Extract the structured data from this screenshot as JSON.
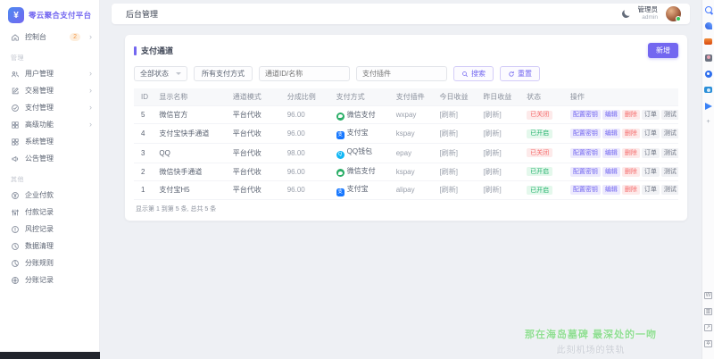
{
  "colors": {
    "accent": "#7367f0",
    "success": "#23b26d",
    "danger": "#f56c6c"
  },
  "sidebar": {
    "logo_title": "零云聚合支付平台",
    "console": {
      "label": "控制台",
      "badge": "2"
    },
    "sections": [
      {
        "label": "管理",
        "items": [
          {
            "label": "用户管理",
            "icon": "users-icon",
            "arrow": true
          },
          {
            "label": "交易管理",
            "icon": "edit-icon",
            "arrow": true
          },
          {
            "label": "支付管理",
            "icon": "check-circle-icon",
            "arrow": true
          },
          {
            "label": "高级功能",
            "icon": "grid-icon",
            "arrow": true
          },
          {
            "label": "系统管理",
            "icon": "modules-icon",
            "arrow": false
          },
          {
            "label": "公告管理",
            "icon": "announcement-icon",
            "arrow": false
          }
        ]
      },
      {
        "label": "其他",
        "items": [
          {
            "label": "企业付款",
            "icon": "enterprise-pay-icon",
            "arrow": false
          },
          {
            "label": "付款记录",
            "icon": "payment-records-icon",
            "arrow": false
          },
          {
            "label": "风控记录",
            "icon": "risk-icon",
            "arrow": false
          },
          {
            "label": "数据清理",
            "icon": "clock-icon",
            "arrow": false
          },
          {
            "label": "分账规则",
            "icon": "split-rules-icon",
            "arrow": false
          },
          {
            "label": "分账记录",
            "icon": "split-records-icon",
            "arrow": false
          }
        ]
      }
    ]
  },
  "topbar": {
    "title": "后台管理",
    "user_name": "管理员",
    "user_role": "admin"
  },
  "panel": {
    "title": "支付通道",
    "add_button": "新增",
    "filters": {
      "status_select": "全部状态",
      "method_select": "所有支付方式",
      "id_placeholder": "通道ID/名称",
      "plugin_placeholder": "支付插件",
      "search_button": "搜索",
      "reset_button": "重置"
    },
    "table": {
      "headers": [
        "ID",
        "显示名称",
        "通道模式",
        "分成比例",
        "支付方式",
        "支付插件",
        "今日收益",
        "昨日收益",
        "状态",
        "操作"
      ],
      "actions": [
        {
          "label": "配置密钥",
          "type": "primary"
        },
        {
          "label": "编辑",
          "type": "primary"
        },
        {
          "label": "删除",
          "type": "danger"
        },
        {
          "label": "订单",
          "type": "plain"
        },
        {
          "label": "测试",
          "type": "plain"
        }
      ],
      "rows": [
        {
          "id": "5",
          "name": "微信官方",
          "mode": "平台代收",
          "ratio": "96.00",
          "method": "微信支付",
          "method_icon": "wechat-pay-icon",
          "plugin": "wxpay",
          "today": "[刷新]",
          "yesterday": "[刷新]",
          "status": "已关闭",
          "status_state": "closed"
        },
        {
          "id": "4",
          "name": "支付宝快手通道",
          "mode": "平台代收",
          "ratio": "96.00",
          "method": "支付宝",
          "method_icon": "alipay-icon",
          "plugin": "kspay",
          "today": "[刷新]",
          "yesterday": "[刷新]",
          "status": "已开启",
          "status_state": "open"
        },
        {
          "id": "3",
          "name": "QQ",
          "mode": "平台代收",
          "ratio": "98.00",
          "method": "QQ钱包",
          "method_icon": "qq-wallet-icon",
          "plugin": "epay",
          "today": "[刷新]",
          "yesterday": "[刷新]",
          "status": "已关闭",
          "status_state": "closed"
        },
        {
          "id": "2",
          "name": "微信快手通道",
          "mode": "平台代收",
          "ratio": "96.00",
          "method": "微信支付",
          "method_icon": "wechat-pay-icon",
          "plugin": "kspay",
          "today": "[刷新]",
          "yesterday": "[刷新]",
          "status": "已开启",
          "status_state": "open"
        },
        {
          "id": "1",
          "name": "支付宝H5",
          "mode": "平台代收",
          "ratio": "96.00",
          "method": "支付宝",
          "method_icon": "alipay-icon",
          "plugin": "alipay",
          "today": "[刷新]",
          "yesterday": "[刷新]",
          "status": "已开启",
          "status_state": "open"
        }
      ],
      "footer": "显示第 1 到第 5 条, 总共 5 条"
    }
  },
  "lyrics": {
    "line1": "那在海岛墓碑 最深处的一吻",
    "line2": "此刻机场的铁轨"
  },
  "browser_strip": {
    "top_icons": [
      "search-icon",
      "comet-icon",
      "briefcase-icon",
      "profile-icon",
      "compass-icon",
      "camera-icon",
      "send-icon",
      "add-icon"
    ],
    "bottom_icons": [
      "wayback-icon",
      "side-panel-icon",
      "external-link-icon",
      "settings-icon"
    ]
  }
}
